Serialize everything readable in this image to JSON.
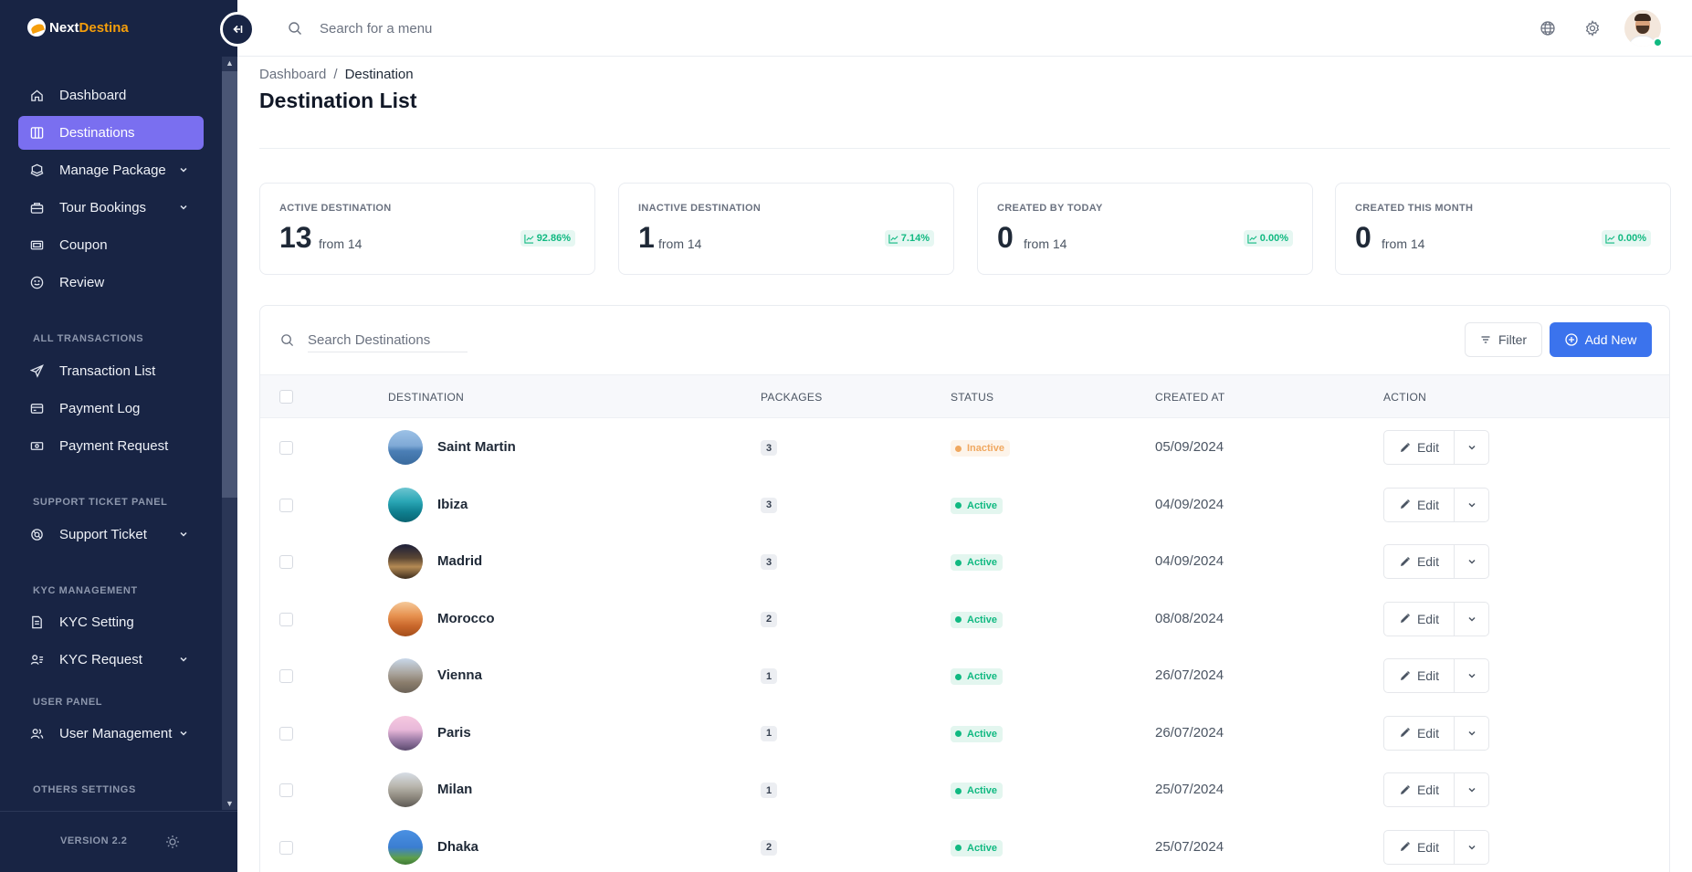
{
  "app": {
    "brand_part1": "Next",
    "brand_part2": "Destina",
    "colors": {
      "sidebar_bg": "#182444",
      "active_item": "#7a6ff0",
      "brand_accent": "#f59e0b",
      "primary": "#3b73ed",
      "success": "#10b981",
      "warning": "#f0a860"
    }
  },
  "sidebar": {
    "main_items": [
      {
        "label": "Dashboard",
        "icon": "home-icon",
        "active": false,
        "expandable": false
      },
      {
        "label": "Destinations",
        "icon": "columns-icon",
        "active": true,
        "expandable": false
      },
      {
        "label": "Manage Package",
        "icon": "package-icon",
        "active": false,
        "expandable": true
      },
      {
        "label": "Tour Bookings",
        "icon": "booking-icon",
        "active": false,
        "expandable": true
      },
      {
        "label": "Coupon",
        "icon": "coupon-icon",
        "active": false,
        "expandable": false
      },
      {
        "label": "Review",
        "icon": "smile-icon",
        "active": false,
        "expandable": false
      }
    ],
    "sections": {
      "transactions": {
        "heading": "ALL TRANSACTIONS",
        "items": [
          "Transaction List",
          "Payment Log",
          "Payment Request"
        ]
      },
      "support": {
        "heading": "SUPPORT TICKET PANEL",
        "items": [
          "Support Ticket"
        ]
      },
      "kyc": {
        "heading": "KYC MANAGEMENT",
        "items": [
          "KYC Setting",
          "KYC Request"
        ]
      },
      "user": {
        "heading": "USER PANEL",
        "items": [
          "User Management"
        ]
      },
      "others": {
        "heading": "OTHERS SETTINGS"
      }
    },
    "version": "VERSION 2.2"
  },
  "topbar": {
    "search_placeholder": "Search for a menu"
  },
  "page": {
    "breadcrumb": [
      "Dashboard",
      "Destination"
    ],
    "breadcrumb_sep": "/",
    "title": "Destination List"
  },
  "stats": [
    {
      "label": "ACTIVE DESTINATION",
      "value": "13",
      "from": "from 14",
      "pct": "92.86%"
    },
    {
      "label": "INACTIVE DESTINATION",
      "value": "1",
      "from": "from 14",
      "pct": "7.14%"
    },
    {
      "label": "CREATED BY TODAY",
      "value": "0",
      "from": "from 14",
      "pct": "0.00%"
    },
    {
      "label": "CREATED THIS MONTH",
      "value": "0",
      "from": "from 14",
      "pct": "0.00%"
    }
  ],
  "table": {
    "search_placeholder": "Search Destinations",
    "filter_label": "Filter",
    "add_label": "Add New",
    "columns": [
      "DESTINATION",
      "PACKAGES",
      "STATUS",
      "CREATED AT",
      "ACTION"
    ],
    "edit_label": "Edit",
    "rows": [
      {
        "name": "Saint Martin",
        "packages": "3",
        "status": "Inactive",
        "created": "05/09/2024"
      },
      {
        "name": "Ibiza",
        "packages": "3",
        "status": "Active",
        "created": "04/09/2024"
      },
      {
        "name": "Madrid",
        "packages": "3",
        "status": "Active",
        "created": "04/09/2024"
      },
      {
        "name": "Morocco",
        "packages": "2",
        "status": "Active",
        "created": "08/08/2024"
      },
      {
        "name": "Vienna",
        "packages": "1",
        "status": "Active",
        "created": "26/07/2024"
      },
      {
        "name": "Paris",
        "packages": "1",
        "status": "Active",
        "created": "26/07/2024"
      },
      {
        "name": "Milan",
        "packages": "1",
        "status": "Active",
        "created": "25/07/2024"
      },
      {
        "name": "Dhaka",
        "packages": "2",
        "status": "Active",
        "created": "25/07/2024"
      }
    ]
  }
}
